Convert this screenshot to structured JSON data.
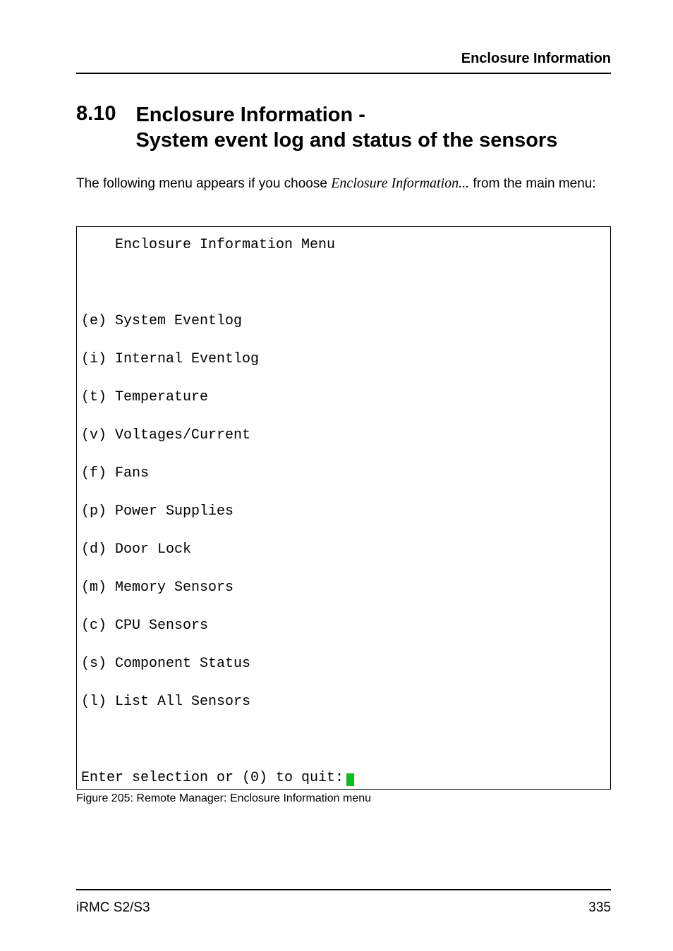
{
  "header": {
    "running_head": "Enclosure Information"
  },
  "section": {
    "number": "8.10",
    "title_line1": "Enclosure Information -",
    "title_line2": "System event log and status of the sensors"
  },
  "intro": {
    "before": "The following menu appears if you choose ",
    "italic": "Enclosure Information...",
    "after": " from the main menu:"
  },
  "terminal": {
    "title": "    Enclosure Information Menu",
    "items": [
      "(e) System Eventlog",
      "(i) Internal Eventlog",
      "(t) Temperature",
      "(v) Voltages/Current",
      "(f) Fans",
      "(p) Power Supplies",
      "(d) Door Lock",
      "(m) Memory Sensors",
      "(c) CPU Sensors",
      "(s) Component Status",
      "(l) List All Sensors"
    ],
    "prompt": "Enter selection or (0) to quit:"
  },
  "caption": "Figure 205: Remote Manager: Enclosure Information menu",
  "footer": {
    "left": "iRMC S2/S3",
    "right": "335"
  }
}
